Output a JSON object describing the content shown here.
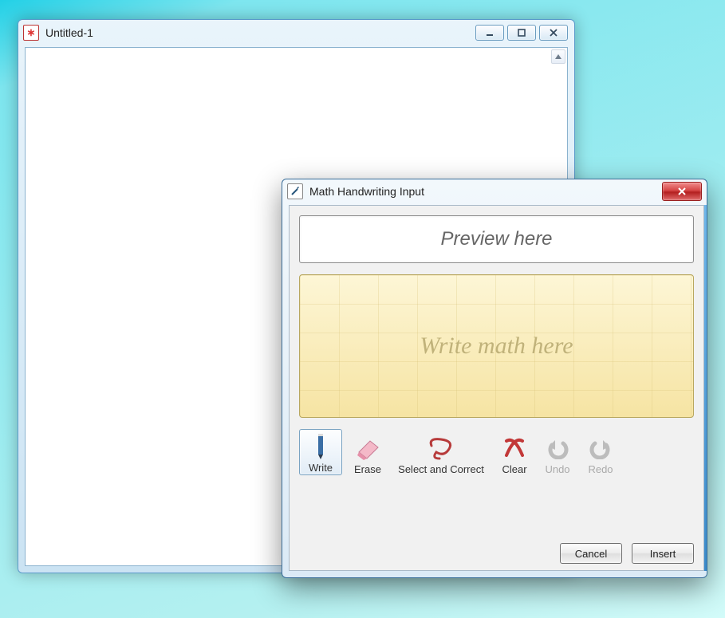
{
  "editor": {
    "title": "Untitled-1",
    "icon_glyph": "∗"
  },
  "dialog": {
    "title": "Math Handwriting Input",
    "preview_placeholder": "Preview here",
    "canvas_placeholder": "Write math here",
    "tools": {
      "write": "Write",
      "erase": "Erase",
      "select": "Select and Correct",
      "clear": "Clear",
      "undo": "Undo",
      "redo": "Redo"
    },
    "buttons": {
      "cancel": "Cancel",
      "insert": "Insert"
    }
  }
}
